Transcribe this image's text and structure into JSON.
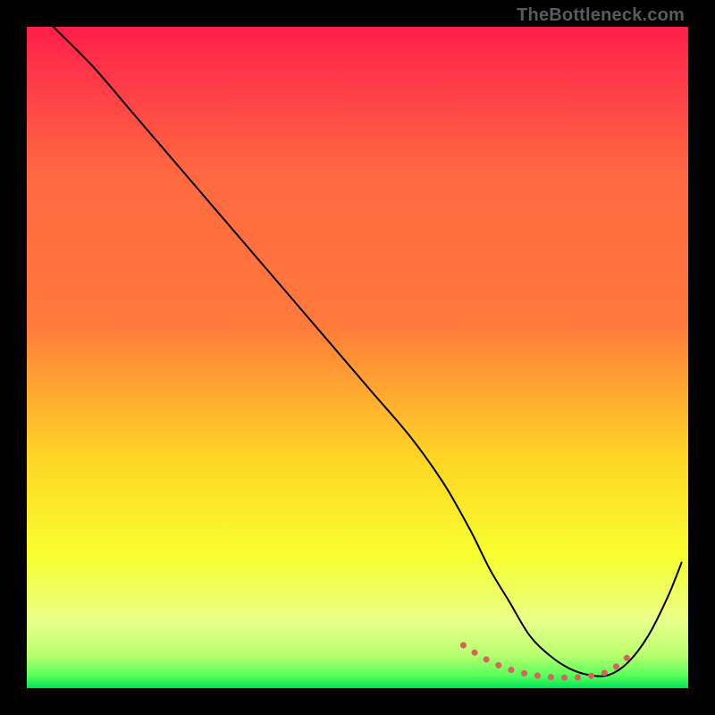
{
  "watermark": "TheBottleneck.com",
  "chart_data": {
    "type": "line",
    "title": "",
    "xlabel": "",
    "ylabel": "",
    "xlim": [
      0,
      100
    ],
    "ylim": [
      0,
      100
    ],
    "grid": false,
    "legend": false,
    "background_gradient": {
      "top_color": "#ff1f4b",
      "mid_upper_color": "#ff7a3c",
      "mid_color": "#ffd524",
      "mid_lower_color": "#f7ff2e",
      "lower_color": "#eaff66",
      "bottom_color": "#00e456"
    },
    "series": [
      {
        "name": "bottleneck-curve",
        "color": "#000000",
        "stroke_width": 2,
        "x": [
          4,
          10,
          16,
          22,
          28,
          34,
          40,
          46,
          52,
          58,
          63,
          67,
          70,
          73,
          76,
          79,
          82,
          85,
          88,
          91,
          94,
          97,
          99
        ],
        "values": [
          100,
          94,
          87,
          80,
          73,
          66,
          59,
          52,
          45,
          38,
          31,
          24,
          18,
          13,
          8,
          5,
          3,
          2,
          2,
          4,
          8,
          14,
          19
        ]
      },
      {
        "name": "optimal-band-markers",
        "color": "#d9625f",
        "style": "dotted",
        "stroke_width": 7,
        "x": [
          66,
          69,
          72,
          75,
          78,
          81,
          84,
          87,
          89,
          91
        ],
        "values": [
          6.5,
          4.6,
          3.2,
          2.3,
          1.8,
          1.6,
          1.7,
          2.2,
          3.2,
          4.8
        ]
      }
    ]
  }
}
